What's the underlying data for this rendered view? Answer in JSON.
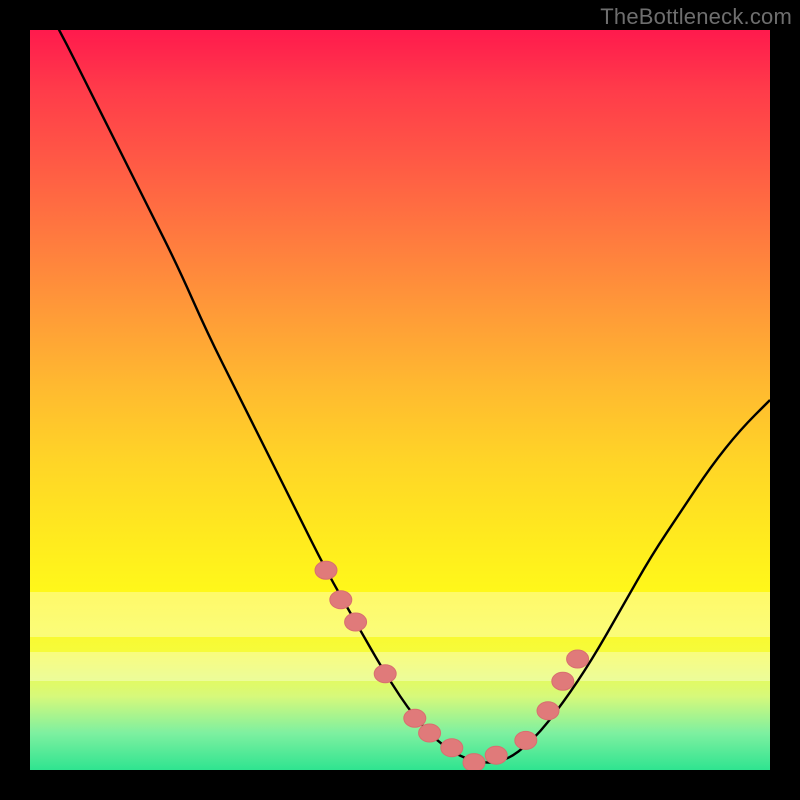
{
  "watermark": "TheBottleneck.com",
  "colors": {
    "frame": "#000000",
    "gradient_top": "#ff1a4d",
    "gradient_bottom": "#2fe490",
    "curve": "#000000",
    "marker_fill": "#e07a7a",
    "marker_stroke": "#d86f6f",
    "pale_band": "rgba(255,255,255,0.35)"
  },
  "chart_data": {
    "type": "line",
    "title": "",
    "xlabel": "",
    "ylabel": "",
    "xlim": [
      0,
      100
    ],
    "ylim": [
      0,
      100
    ],
    "grid": false,
    "legend": false,
    "series": [
      {
        "name": "bottleneck-curve",
        "x": [
          0,
          4,
          8,
          12,
          16,
          20,
          24,
          28,
          32,
          36,
          40,
          44,
          48,
          52,
          56,
          60,
          64,
          68,
          72,
          76,
          80,
          84,
          88,
          92,
          96,
          100
        ],
        "y": [
          107,
          100,
          92,
          84,
          76,
          68,
          59,
          51,
          43,
          35,
          27,
          20,
          13,
          7,
          3,
          1,
          1,
          4,
          9,
          15,
          22,
          29,
          35,
          41,
          46,
          50
        ]
      }
    ],
    "markers": {
      "name": "highlight-points",
      "x": [
        40,
        42,
        44,
        48,
        52,
        54,
        57,
        60,
        63,
        67,
        70,
        72,
        74
      ],
      "y": [
        27,
        23,
        20,
        13,
        7,
        5,
        3,
        1,
        2,
        4,
        8,
        12,
        15
      ]
    },
    "pale_bands_y": [
      [
        18,
        24
      ],
      [
        12,
        16
      ]
    ]
  }
}
